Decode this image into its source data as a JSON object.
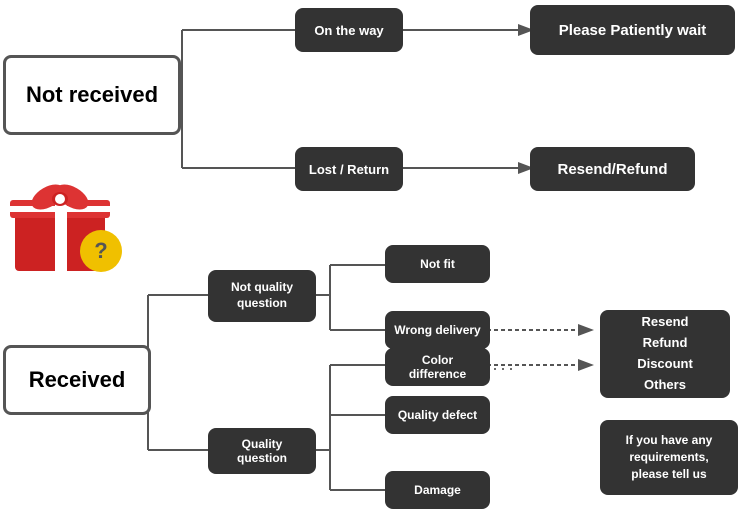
{
  "boxes": {
    "not_received": {
      "label": "Not received"
    },
    "on_the_way": {
      "label": "On the way"
    },
    "please_wait": {
      "label": "Please Patiently wait"
    },
    "lost_return": {
      "label": "Lost / Return"
    },
    "resend_refund_top": {
      "label": "Resend/Refund"
    },
    "received": {
      "label": "Received"
    },
    "not_quality": {
      "label": "Not quality\nquestion"
    },
    "not_fit": {
      "label": "Not fit"
    },
    "wrong_delivery": {
      "label": "Wrong delivery"
    },
    "quality_question": {
      "label": "Quality question"
    },
    "color_diff": {
      "label": "Color difference"
    },
    "quality_defect": {
      "label": "Quality defect"
    },
    "damage": {
      "label": "Damage"
    },
    "resend_options": {
      "label": "Resend\nRefund\nDiscount\nOthers"
    },
    "requirements": {
      "label": "If you have any\nrequirements,\nplease tell us"
    }
  }
}
